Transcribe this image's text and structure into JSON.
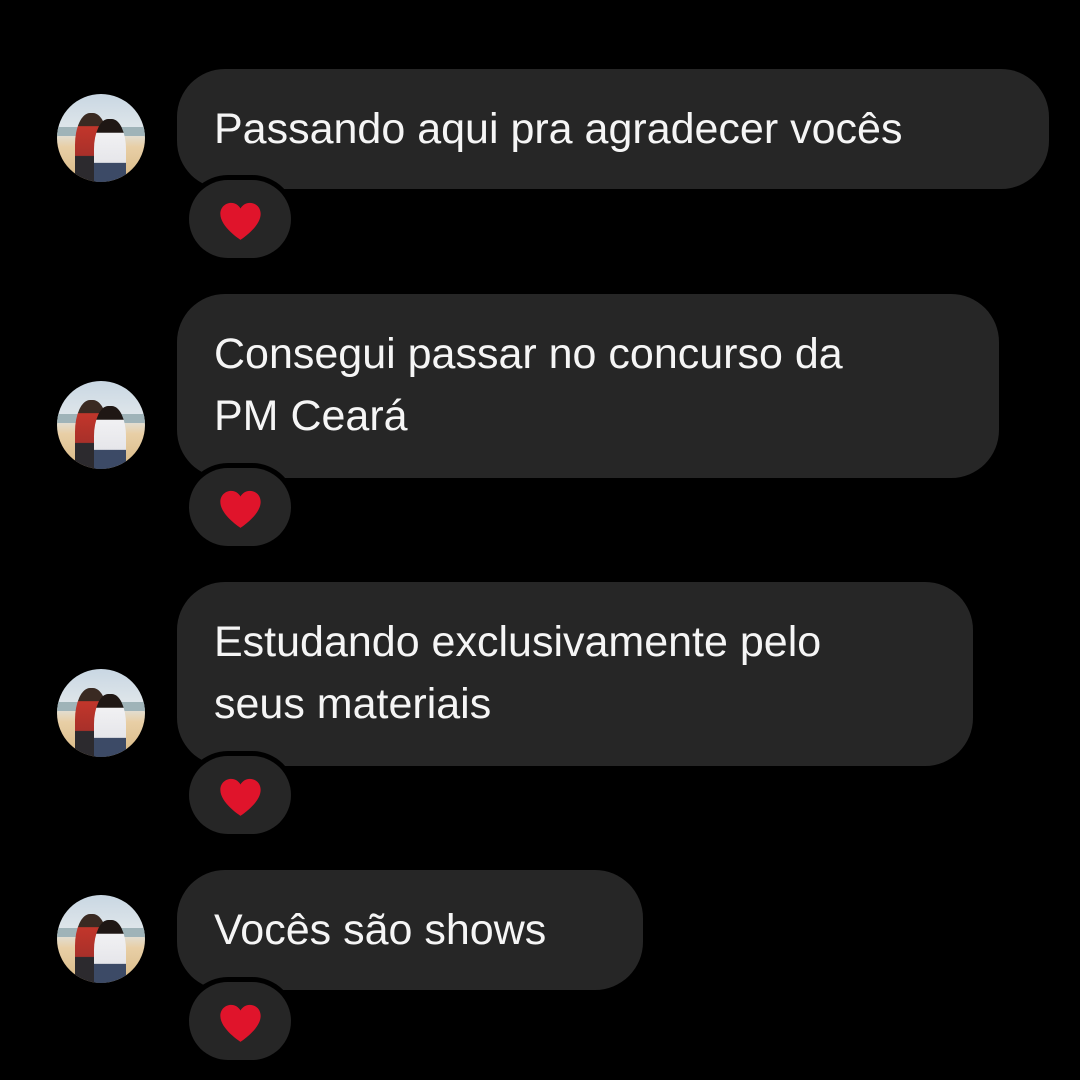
{
  "colors": {
    "background": "#000000",
    "bubble": "#262626",
    "text": "#f5f5f5",
    "heart": "#e0142b"
  },
  "messages": [
    {
      "text": "Passando aqui pra agradecer vocês",
      "reaction": "heart-icon"
    },
    {
      "text": "Consegui passar no concurso da\nPM Ceará",
      "reaction": "heart-icon"
    },
    {
      "text": "Estudando exclusivamente pelo\nseus materiais",
      "reaction": "heart-icon"
    },
    {
      "text": "Vocês são shows",
      "reaction": "heart-icon"
    }
  ]
}
